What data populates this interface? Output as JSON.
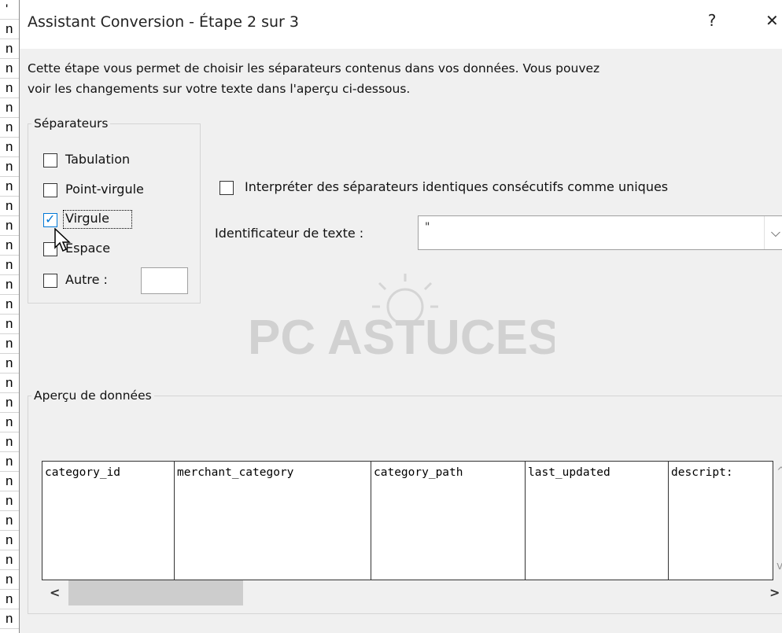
{
  "background_sheet": {
    "cells": [
      "'",
      "n",
      "n",
      "n",
      "n",
      "n",
      "n",
      "n",
      "n",
      "n",
      "n",
      "n",
      "n",
      "n",
      "n",
      "n",
      "n",
      "n",
      "n",
      "n",
      "n",
      "n",
      "n",
      "n",
      "n",
      "n",
      "n",
      "n",
      "n",
      "n",
      "n",
      "n"
    ]
  },
  "dialog": {
    "title": "Assistant Conversion - Étape 2 sur 3",
    "help_label": "?",
    "close_label": "✕",
    "intro_line1": "Cette étape vous permet de choisir les séparateurs contenus dans vos données. Vous pouvez",
    "intro_line2": "voir les changements sur votre texte dans l'aperçu ci-dessous."
  },
  "separators": {
    "legend": "Séparateurs",
    "tab": {
      "label": "Tabulation",
      "checked": false
    },
    "semicolon": {
      "label": "Point-virgule",
      "checked": false
    },
    "comma": {
      "label": "Virgule",
      "checked": true
    },
    "space": {
      "label": "Espace",
      "checked": false
    },
    "other": {
      "label": "Autre :",
      "checked": false,
      "value": ""
    }
  },
  "consecutive": {
    "label": "Interpréter des séparateurs identiques consécutifs comme uniques",
    "checked": false
  },
  "text_qualifier": {
    "label": "Identificateur de texte :",
    "value": "\""
  },
  "watermark": {
    "text": "PC ASTUCES"
  },
  "preview": {
    "legend": "Aperçu de données",
    "columns": [
      "category_id",
      "merchant_category",
      "category_path",
      "last_updated",
      "descript:"
    ]
  },
  "scroll": {
    "up": "^",
    "down": "v",
    "left": "<",
    "right": ">"
  }
}
